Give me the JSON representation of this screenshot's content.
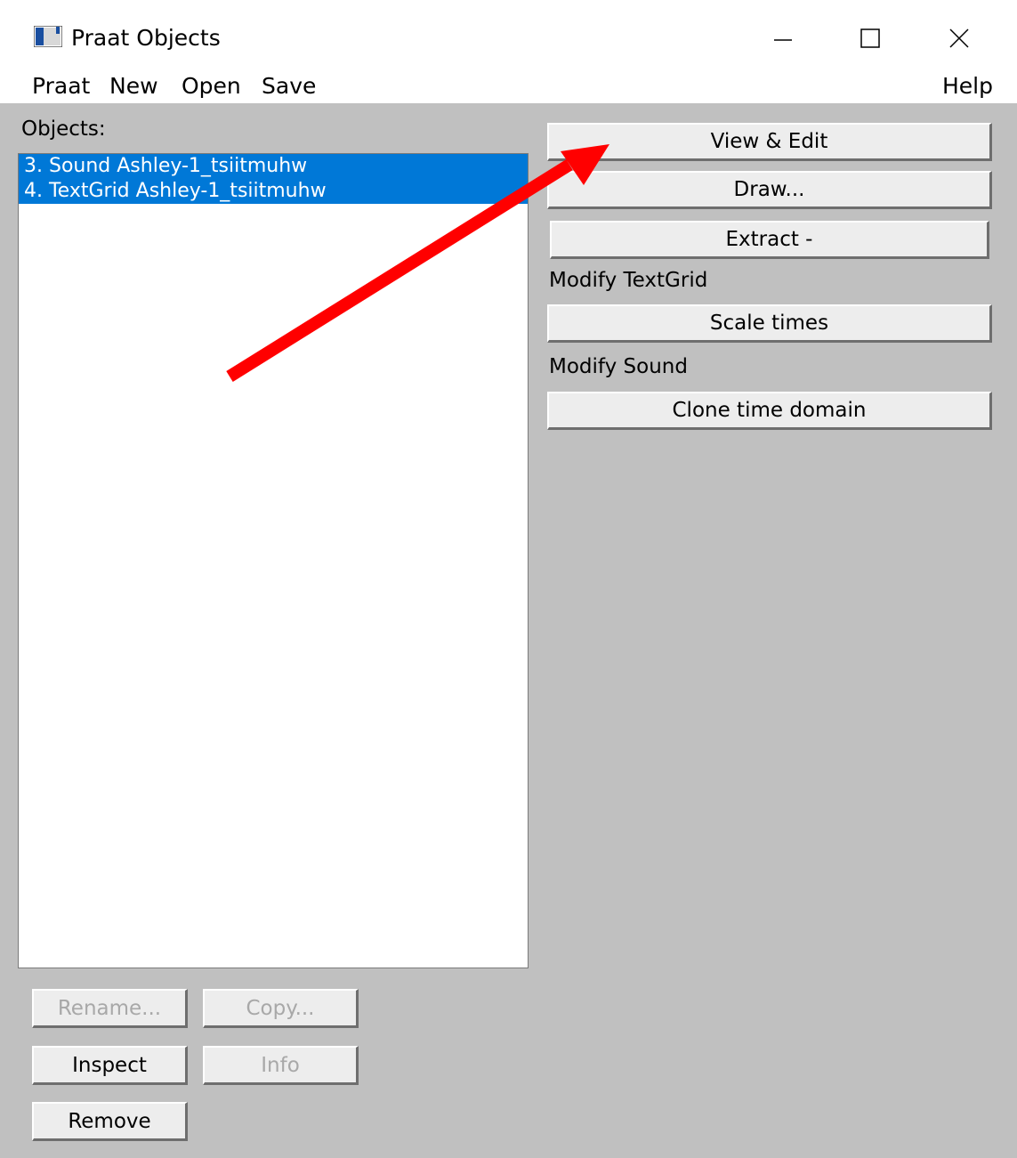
{
  "window": {
    "title": "Praat Objects",
    "icon": "praat-app-icon",
    "controls": [
      "minimize-icon",
      "maximize-icon",
      "close-icon"
    ]
  },
  "menu": {
    "items": [
      "Praat",
      "New",
      "Open",
      "Save"
    ],
    "help": "Help"
  },
  "objects": {
    "label": "Objects:",
    "items": [
      {
        "label": "3. Sound Ashley-1_tsiitmuhw",
        "selected": true
      },
      {
        "label": "4. TextGrid Ashley-1_tsiitmuhw",
        "selected": true
      }
    ]
  },
  "actions": {
    "view_edit": "View & Edit",
    "draw": "Draw...",
    "extract": "Extract -",
    "modify_textgrid_label": "Modify TextGrid",
    "scale_times": "Scale times",
    "modify_sound_label": "Modify Sound",
    "clone_time_domain": "Clone time domain"
  },
  "bottom_buttons": {
    "rename": "Rename...",
    "copy": "Copy...",
    "inspect": "Inspect",
    "info": "Info",
    "remove": "Remove"
  },
  "colors": {
    "selection": "#0078d7",
    "annotation_arrow": "#ff0000",
    "panel_background": "#c0c0c0"
  },
  "annotation": {
    "icon": "red-arrow-icon",
    "points_to": "View & Edit"
  }
}
